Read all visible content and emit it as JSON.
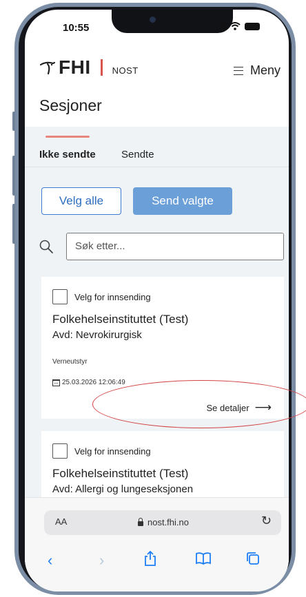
{
  "status": {
    "time": "10:55"
  },
  "header": {
    "brand": "FHI",
    "product": "NOST",
    "menu_label": "Meny"
  },
  "page": {
    "title": "Sesjoner"
  },
  "tabs": [
    {
      "label": "Ikke sendte",
      "active": true
    },
    {
      "label": "Sendte",
      "active": false
    }
  ],
  "actions": {
    "select_all": "Velg alle",
    "send_selected": "Send valgte"
  },
  "search": {
    "placeholder": "Søk etter..."
  },
  "cards": [
    {
      "checkbox_label": "Velg for innsending",
      "organization": "Folkehelseinstituttet (Test)",
      "department": "Avd: Nevrokirurgisk",
      "tag": "Verneutstyr",
      "datetime": "25.03.2026 12:06:49",
      "details_label": "Se detaljer"
    },
    {
      "checkbox_label": "Velg for innsending",
      "organization": "Folkehelseinstituttet (Test)",
      "department": "Avd: Allergi og lungeseksjonen"
    }
  ],
  "browser": {
    "text_size": "AA",
    "url": "nost.fhi.no"
  },
  "colors": {
    "accent": "#3b7bd4",
    "tab_indicator": "#e8867d",
    "highlight": "#d24141"
  }
}
